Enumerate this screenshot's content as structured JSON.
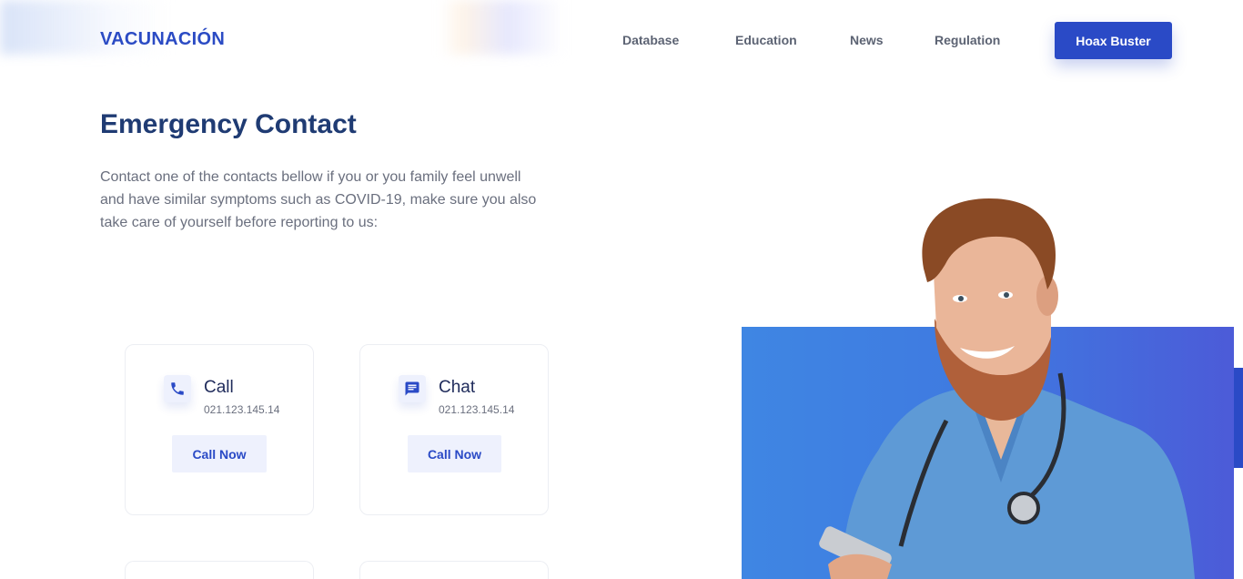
{
  "brand": {
    "logo": "VACUNACIÓN",
    "accent": "#2a4ac6"
  },
  "nav": {
    "links": [
      "Database",
      "Education",
      "News",
      "Regulation"
    ],
    "cta": "Hoax Buster"
  },
  "main": {
    "title": "Emergency Contact",
    "description": "Contact one of the contacts bellow if you or you family feel unwell and have similar symptoms such as COVID-19, make sure you also take care of yourself before reporting to us:"
  },
  "contacts": [
    {
      "icon": "phone-icon",
      "title": "Call",
      "number": "021.123.145.14",
      "button": "Call Now"
    },
    {
      "icon": "chat-icon",
      "title": "Chat",
      "number": "021.123.145.14",
      "button": "Call Now"
    }
  ],
  "hero": {
    "image": "doctor-photo",
    "background": "#3f7fe1"
  }
}
